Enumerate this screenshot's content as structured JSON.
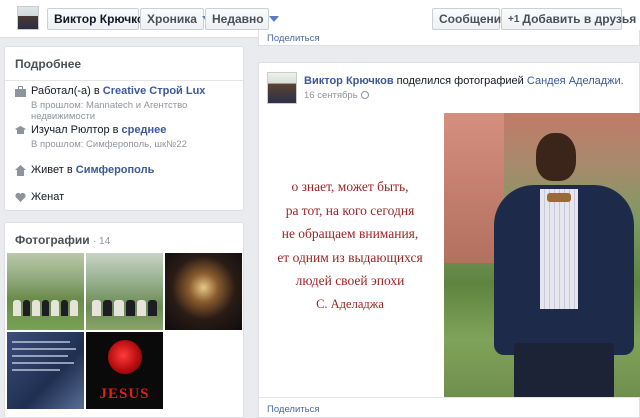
{
  "topbar": {
    "profile_name": "Виктор Крючков",
    "chronicle_label": "Хроника",
    "recent_label": "Недавно",
    "message_label": "Сообщение",
    "add_friend_label": "Добавить в друзья",
    "add_friend_prefix": "+1"
  },
  "about": {
    "title": "Подробнее",
    "work_prefix": "Работал(-а) в",
    "work_place": "Creative Строй Lux",
    "work_past": "В прошлом: Mannatech и Агентство недвижимости",
    "edu_prefix": "Изучал Рюлтор в",
    "edu_place": "среднее",
    "edu_past": "В прошлом: Симферополь, шк№22",
    "lives_prefix": "Живет в",
    "lives_place": "Симферополь",
    "relationship": "Женат"
  },
  "photos": {
    "title": "Фотографии",
    "count": "· 14",
    "thumb_jesus_text": "JESUS"
  },
  "previous_post": {
    "share_label": "Поделиться"
  },
  "post": {
    "author": "Виктор Крючков",
    "action": "поделился фотографией",
    "source": "Сандея Аделаджи.",
    "date": "16 сентябрь",
    "quote_lines": [
      "о знает, может быть,",
      "ра тот, на кого сегодня",
      "не обращаем внимания,",
      "ет одним из выдающихся",
      "людей своей эпохи"
    ],
    "quote_author": "С. Аделаджа",
    "share_label": "Поделиться"
  }
}
